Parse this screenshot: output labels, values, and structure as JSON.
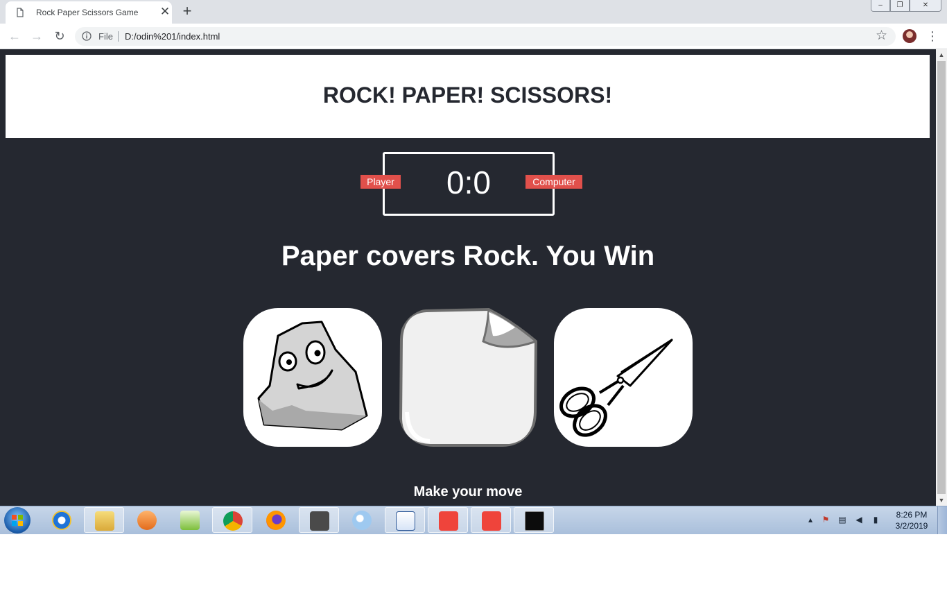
{
  "browser": {
    "tab_title": "Rock Paper Scissors Game",
    "tab_close": "✕",
    "new_tab": "+",
    "file_label": "File",
    "url": "D:/odin%201/index.html",
    "back": "←",
    "forward": "→",
    "reload": "↻",
    "star": "☆",
    "menu": "⋮",
    "window_controls": {
      "minimize": "–",
      "maximize": "❐",
      "close": "✕"
    }
  },
  "page": {
    "title": "ROCK! PAPER! SCISSORS!",
    "score": "0:0",
    "player_label": "Player",
    "computer_label": "Computer",
    "result": "Paper covers Rock. You Win",
    "prompt": "Make your move",
    "choices": [
      "rock",
      "paper",
      "scissors"
    ]
  },
  "colors": {
    "page_bg": "#252830",
    "badge": "#e1504b",
    "header_bg": "#ffffff"
  },
  "taskbar": {
    "apps": [
      "internet-explorer",
      "file-explorer",
      "media-player",
      "notepad-plus",
      "chrome",
      "firefox",
      "sublime-text",
      "paint",
      "word",
      "anydesk",
      "anydesk",
      "command-prompt"
    ],
    "clock_time": "8:26 PM",
    "clock_date": "3/2/2019"
  }
}
